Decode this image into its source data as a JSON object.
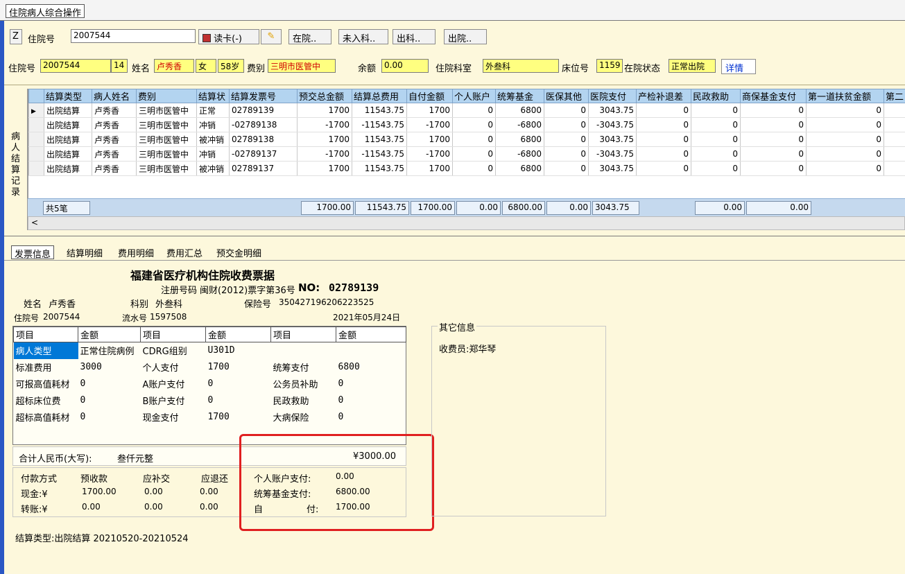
{
  "window": {
    "title": "住院病人综合操作"
  },
  "toolbar": {
    "z_label": "Z",
    "inpatient_no_label": "住院号",
    "inpatient_no_value": "2007544",
    "read_card_label": "读卡(-)",
    "buttons": [
      "在院..",
      "未入科..",
      "出科..",
      "出院.."
    ]
  },
  "patient": {
    "inpatient_no_label": "住院号",
    "inpatient_no": "2007544",
    "bed_count": "14",
    "name_label": "姓名",
    "name": "卢秀香",
    "gender": "女",
    "age": "58岁",
    "fee_type_label": "费别",
    "fee_type": "三明市医管中",
    "balance_label": "余额",
    "balance": "0.00",
    "dept_label": "住院科室",
    "dept": "外叁科",
    "bed_label": "床位号",
    "bed": "1159",
    "status_label": "在院状态",
    "status": "正常出院",
    "detail_link": "详情"
  },
  "settlement_grid": {
    "side_label": [
      "病",
      "人",
      "结",
      "算",
      "记",
      "录"
    ],
    "columns": [
      "结算类型",
      "病人姓名",
      "费别",
      "结算状",
      "结算发票号",
      "预交总金额",
      "结算总费用",
      "自付金额",
      "个人账户",
      "统筹基金",
      "医保其他",
      "医院支付",
      "产检补退差",
      "民政救助",
      "商保基金支付",
      "第一道扶贫金额",
      "第二"
    ],
    "rows": [
      [
        "出院结算",
        "卢秀香",
        "三明市医管中",
        "正常",
        "02789139",
        "1700",
        "11543.75",
        "1700",
        "0",
        "6800",
        "0",
        "3043.75",
        "0",
        "0",
        "0",
        "0"
      ],
      [
        "出院结算",
        "卢秀香",
        "三明市医管中",
        "冲销",
        "-02789138",
        "-1700",
        "-11543.75",
        "-1700",
        "0",
        "-6800",
        "0",
        "-3043.75",
        "0",
        "0",
        "0",
        "0"
      ],
      [
        "出院结算",
        "卢秀香",
        "三明市医管中",
        "被冲销",
        "02789138",
        "1700",
        "11543.75",
        "1700",
        "0",
        "6800",
        "0",
        "3043.75",
        "0",
        "0",
        "0",
        "0"
      ],
      [
        "出院结算",
        "卢秀香",
        "三明市医管中",
        "冲销",
        "-02789137",
        "-1700",
        "-11543.75",
        "-1700",
        "0",
        "-6800",
        "0",
        "-3043.75",
        "0",
        "0",
        "0",
        "0"
      ],
      [
        "出院结算",
        "卢秀香",
        "三明市医管中",
        "被冲销",
        "02789137",
        "1700",
        "11543.75",
        "1700",
        "0",
        "6800",
        "0",
        "3043.75",
        "0",
        "0",
        "0",
        "0"
      ]
    ],
    "summary": {
      "count": "共5笔",
      "prepay_total": "1700.00",
      "fee_total": "11543.75",
      "self_pay": "1700.00",
      "personal_account": "0.00",
      "pooled_fund": "6800.00",
      "insurance_other": "0.00",
      "hospital_pay": "3043.75",
      "civil_aid": "0.00",
      "commercial": "0.00"
    }
  },
  "tabs": [
    "发票信息",
    "结算明细",
    "费用明细",
    "费用汇总",
    "预交金明细"
  ],
  "invoice": {
    "title": "福建省医疗机构住院收费票据",
    "reg_label": "注册号码",
    "reg_value": "闽财(2012)票字第36号",
    "no_label": "NO:",
    "no_value": "02789139",
    "name_label": "姓名",
    "name": "卢秀香",
    "dept_label": "科别",
    "dept": "外叁科",
    "insurance_label": "保险号",
    "insurance": "350427196206223525",
    "inpatient_label": "住院号",
    "inpatient": "2007544",
    "serial_label": "流水号",
    "serial": "1597508",
    "date": "2021年05月24日",
    "table_headers": [
      "项目",
      "金额",
      "项目",
      "金额",
      "项目",
      "金额"
    ],
    "rows": [
      [
        "病人类型",
        "正常住院病例",
        "CDRG组别",
        "U301D",
        "",
        ""
      ],
      [
        "标准费用",
        "3000",
        "个人支付",
        "1700",
        "统筹支付",
        "6800"
      ],
      [
        "可报高值耗材",
        "0",
        "A账户支付",
        "0",
        "公务员补助",
        "0"
      ],
      [
        "超标床位费",
        "0",
        "B账户支付",
        "0",
        "民政救助",
        "0"
      ],
      [
        "超标高值耗材",
        "0",
        "现金支付",
        "1700",
        "大病保险",
        "0"
      ]
    ],
    "total_label": "合计人民币(大写):",
    "total_chinese": "叁仟元整",
    "total_amount": "¥3000.00",
    "payment_headers": [
      "付款方式",
      "预收款",
      "应补交",
      "应退还"
    ],
    "cash_label": "现金:¥",
    "cash_values": [
      "1700.00",
      "0.00",
      "0.00"
    ],
    "transfer_label": "转账:¥",
    "transfer_values": [
      "0.00",
      "0.00",
      "0.00"
    ],
    "personal_account_label": "个人账户支付:",
    "personal_account_value": "0.00",
    "pooled_label": "统筹基金支付:",
    "pooled_value": "6800.00",
    "self_label_1": "自",
    "self_label_2": "付:",
    "self_value": "1700.00",
    "settle_type": "结算类型:出院结算 20210520-20210524"
  },
  "other_info": {
    "legend": "其它信息",
    "cashier": "收费员:郑华琴"
  },
  "colors": {
    "highlight": "#e02020",
    "yellow_field": "#ffff80",
    "grid_header": "#b3d4f0",
    "selected_cell": "#0078d7"
  }
}
